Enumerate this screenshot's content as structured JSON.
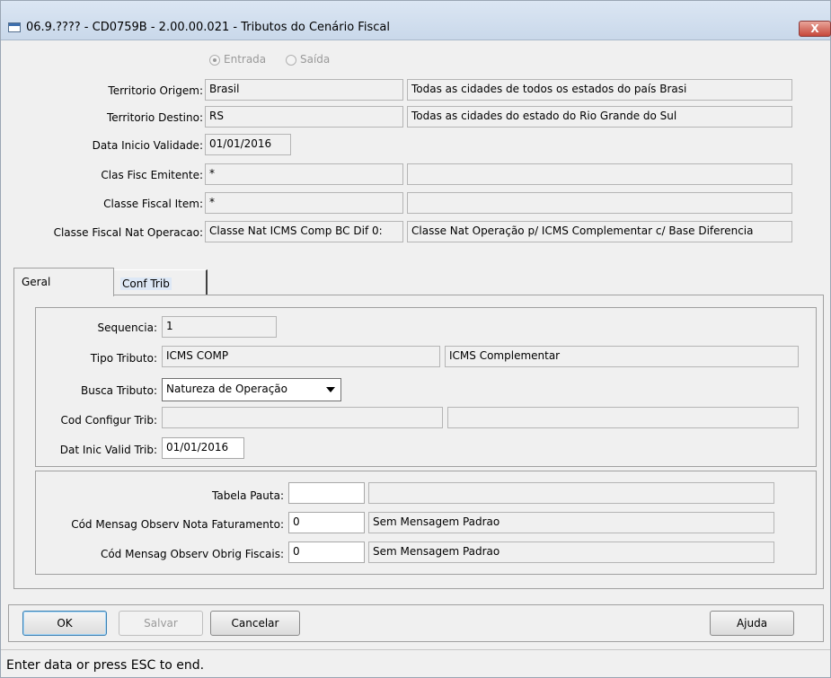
{
  "window": {
    "title": "06.9.???? - CD0759B - 2.00.00.021 - Tributos do Cenário Fiscal",
    "close_label": "X"
  },
  "direction": {
    "options": [
      "Entrada",
      "Saída"
    ],
    "selected": "Entrada"
  },
  "header_fields": {
    "territorio_origem": {
      "label": "Territorio Origem:",
      "code": "Brasil",
      "desc": "Todas as cidades de todos os estados do país Brasi"
    },
    "territorio_destino": {
      "label": "Territorio Destino:",
      "code": "RS",
      "desc": "Todas as cidades do estado do Rio Grande do Sul"
    },
    "data_inicio": {
      "label": "Data Inicio Validade:",
      "value": "01/01/2016"
    },
    "clas_fisc_emitente": {
      "label": "Clas Fisc Emitente:",
      "code": "*",
      "desc": ""
    },
    "classe_fiscal_item": {
      "label": "Classe Fiscal Item:",
      "code": "*",
      "desc": ""
    },
    "classe_fiscal_nat": {
      "label": "Classe Fiscal Nat Operacao:",
      "code": "Classe Nat ICMS Comp BC Dif 0:",
      "desc": "Classe Nat Operação p/ ICMS Complementar c/ Base Diferencia"
    }
  },
  "tabs": [
    {
      "label": "Geral",
      "active": true
    },
    {
      "label": "Conf Trib",
      "active": false
    }
  ],
  "geral": {
    "sequencia": {
      "label": "Sequencia:",
      "value": "1"
    },
    "tipo_tributo": {
      "label": "Tipo Tributo:",
      "code": "ICMS COMP",
      "desc": "ICMS Complementar"
    },
    "busca_tributo": {
      "label": "Busca Tributo:",
      "value": "Natureza de Operação"
    },
    "cod_configur_trib": {
      "label": "Cod Configur Trib:",
      "code": "",
      "desc": ""
    },
    "dat_inic_valid_trib": {
      "label": "Dat Inic Valid Trib:",
      "value": "01/01/2016"
    }
  },
  "mensagens": {
    "tabela_pauta": {
      "label": "Tabela Pauta:",
      "value": "",
      "desc": ""
    },
    "cod_mensag_nota": {
      "label": "Cód Mensag Observ Nota Faturamento:",
      "value": "0",
      "desc": "Sem Mensagem Padrao"
    },
    "cod_mensag_obrig": {
      "label": "Cód Mensag Observ Obrig Fiscais:",
      "value": "0",
      "desc": "Sem Mensagem Padrao"
    }
  },
  "buttons": {
    "ok": "OK",
    "salvar": "Salvar",
    "cancelar": "Cancelar",
    "ajuda": "Ajuda"
  },
  "status": "Enter data or press ESC to end."
}
